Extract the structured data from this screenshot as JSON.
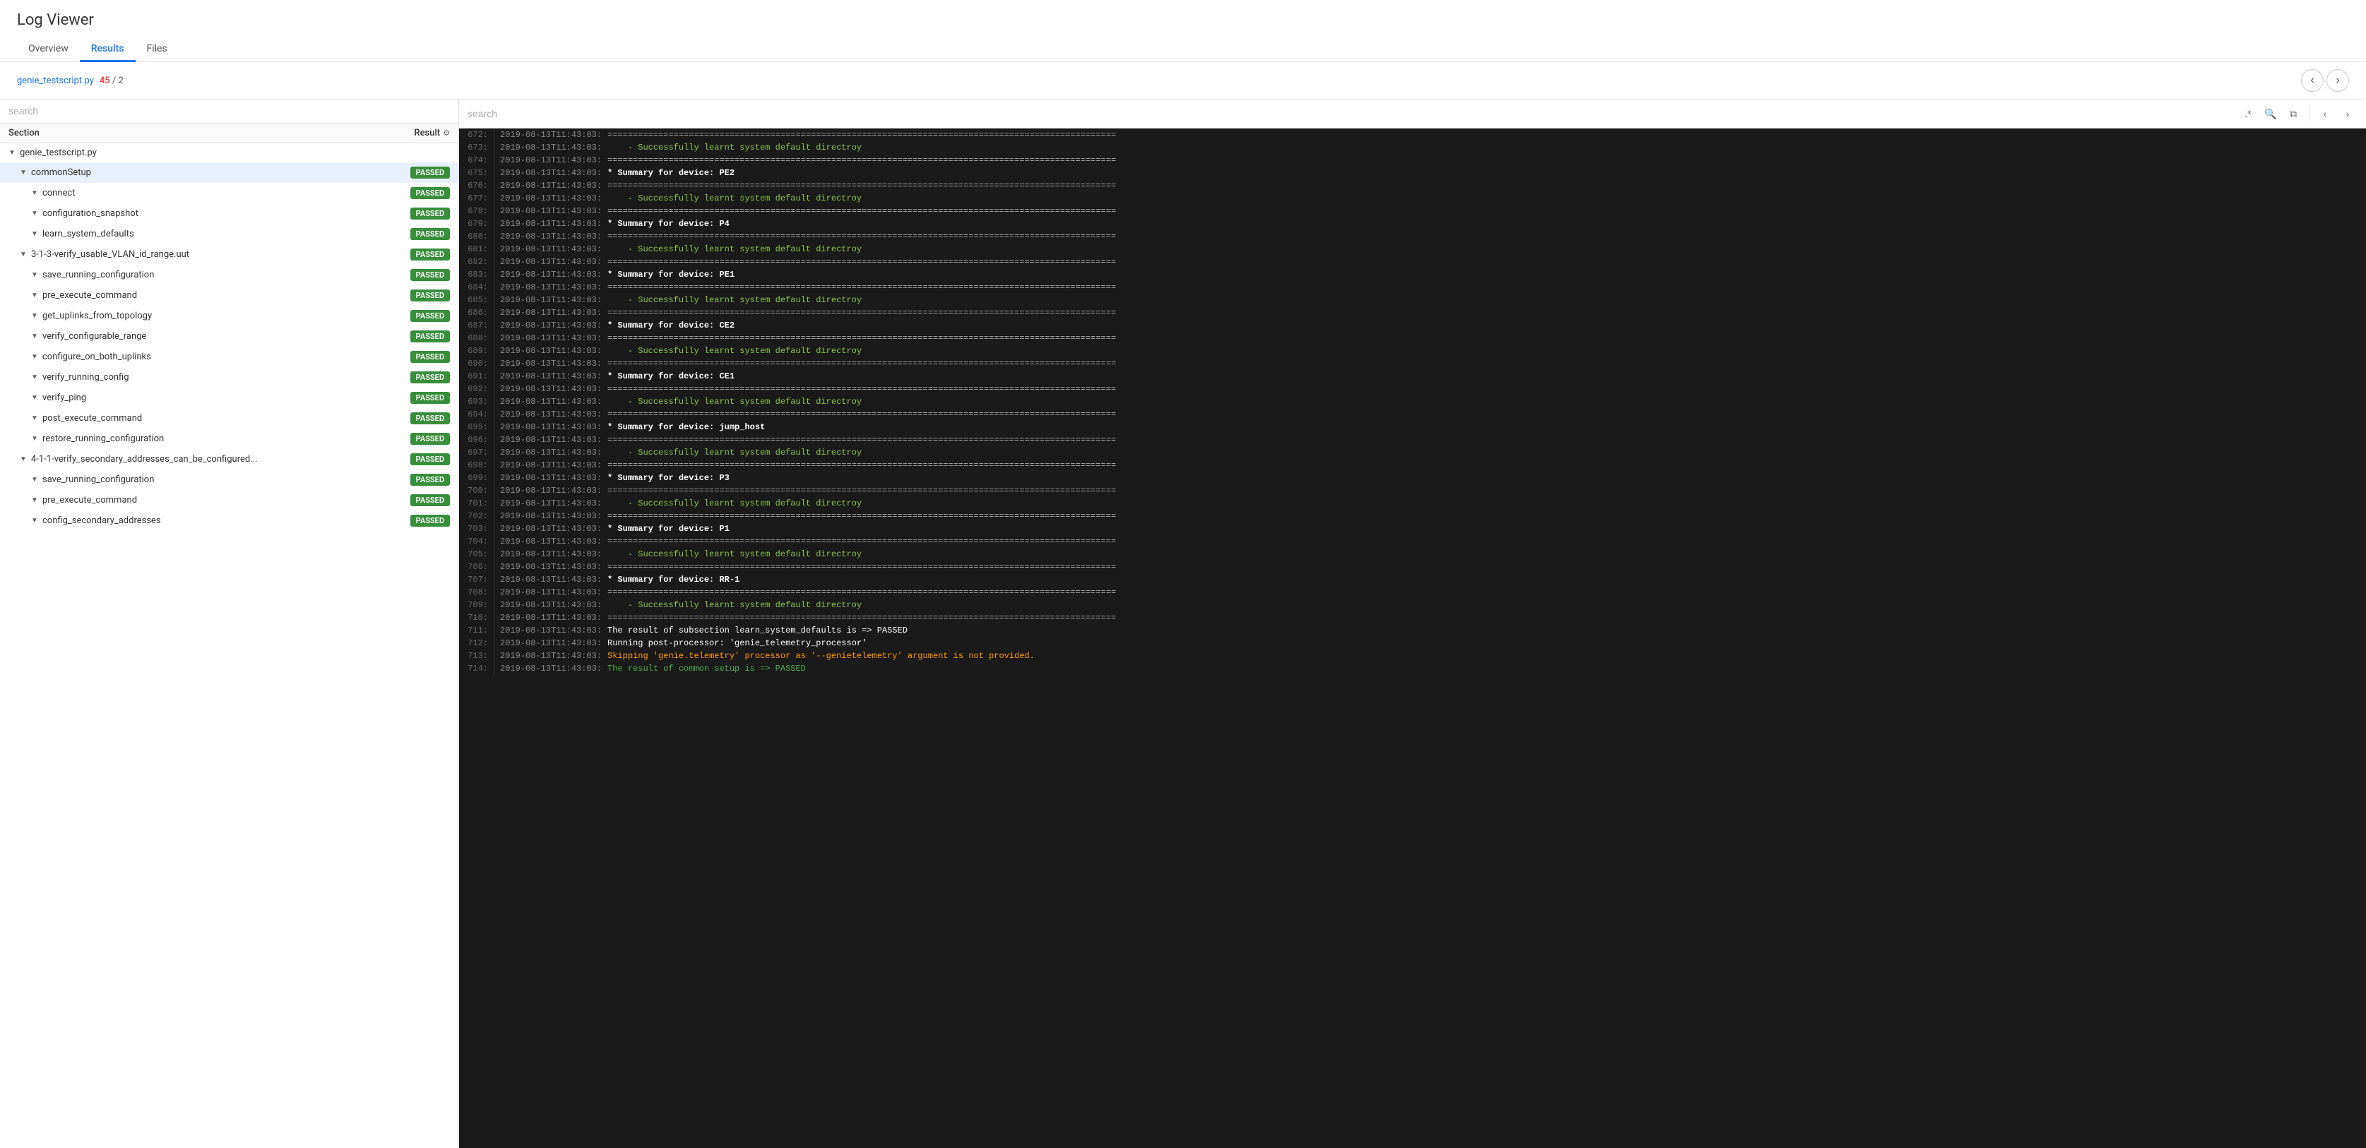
{
  "app": {
    "title": "Log Viewer"
  },
  "tabs": [
    {
      "id": "overview",
      "label": "Overview",
      "active": false
    },
    {
      "id": "results",
      "label": "Results",
      "active": true
    },
    {
      "id": "files",
      "label": "Files",
      "active": false
    }
  ],
  "subheader": {
    "file_name": "genie_testscript.py",
    "match_current": "45",
    "match_separator": "/",
    "match_total": "2"
  },
  "left_panel": {
    "search_placeholder": "search",
    "col_section": "Section",
    "col_result": "Result",
    "tree_items": [
      {
        "id": "genie_testscript",
        "label": "genie_testscript.py",
        "indent": 1,
        "chevron": "▼",
        "badge": null
      },
      {
        "id": "commonSetup",
        "label": "commonSetup",
        "indent": 2,
        "chevron": "▼",
        "badge": "PASSED",
        "selected": true
      },
      {
        "id": "connect",
        "label": "connect",
        "indent": 3,
        "chevron": "▼",
        "badge": "PASSED"
      },
      {
        "id": "configuration_snapshot",
        "label": "configuration_snapshot",
        "indent": 3,
        "chevron": "▼",
        "badge": "PASSED"
      },
      {
        "id": "learn_system_defaults",
        "label": "learn_system_defaults",
        "indent": 3,
        "chevron": "▼",
        "badge": "PASSED"
      },
      {
        "id": "verify_usable_vlan",
        "label": "3-1-3-verify_usable_VLAN_id_range.uut",
        "indent": 2,
        "chevron": "▼",
        "badge": "PASSED"
      },
      {
        "id": "save_running_config1",
        "label": "save_running_configuration",
        "indent": 3,
        "chevron": "▼",
        "badge": "PASSED"
      },
      {
        "id": "pre_execute_command1",
        "label": "pre_execute_command",
        "indent": 3,
        "chevron": "▼",
        "badge": "PASSED"
      },
      {
        "id": "get_uplinks",
        "label": "get_uplinks_from_topology",
        "indent": 3,
        "chevron": "▼",
        "badge": "PASSED"
      },
      {
        "id": "verify_configurable_range",
        "label": "verify_configurable_range",
        "indent": 3,
        "chevron": "▼",
        "badge": "PASSED"
      },
      {
        "id": "configure_on_both",
        "label": "configure_on_both_uplinks",
        "indent": 3,
        "chevron": "▼",
        "badge": "PASSED"
      },
      {
        "id": "verify_running_config",
        "label": "verify_running_config",
        "indent": 3,
        "chevron": "▼",
        "badge": "PASSED"
      },
      {
        "id": "verify_ping",
        "label": "verify_ping",
        "indent": 3,
        "chevron": "▼",
        "badge": "PASSED"
      },
      {
        "id": "post_execute_command1",
        "label": "post_execute_command",
        "indent": 3,
        "chevron": "▼",
        "badge": "PASSED"
      },
      {
        "id": "restore_running_config1",
        "label": "restore_running_configuration",
        "indent": 3,
        "chevron": "▼",
        "badge": "PASSED"
      },
      {
        "id": "verify_secondary",
        "label": "4-1-1-verify_secondary_addresses_can_be_configured...",
        "indent": 2,
        "chevron": "▼",
        "badge": "PASSED"
      },
      {
        "id": "save_running_config2",
        "label": "save_running_configuration",
        "indent": 3,
        "chevron": "▼",
        "badge": "PASSED"
      },
      {
        "id": "pre_execute_command2",
        "label": "pre_execute_command",
        "indent": 3,
        "chevron": "▼",
        "badge": "PASSED"
      },
      {
        "id": "config_secondary",
        "label": "config_secondary_addresses",
        "indent": 3,
        "chevron": "▼",
        "badge": "PASSED"
      }
    ]
  },
  "right_panel": {
    "search_placeholder": "search",
    "log_lines": [
      {
        "num": "672:",
        "time": "2019-08-13T11:43:03:",
        "content": "====================================================================================================",
        "style": "highlight-eq"
      },
      {
        "num": "673:",
        "time": "2019-08-13T11:43:03:",
        "content": "    - Successfully learnt system default directroy",
        "style": "highlight-dash"
      },
      {
        "num": "674:",
        "time": "2019-08-13T11:43:03:",
        "content": "====================================================================================================",
        "style": "highlight-eq"
      },
      {
        "num": "675:",
        "time": "2019-08-13T11:43:03:",
        "content": "* Summary for device: PE2",
        "style": "highlight-star"
      },
      {
        "num": "676:",
        "time": "2019-08-13T11:43:03:",
        "content": "====================================================================================================",
        "style": "highlight-eq"
      },
      {
        "num": "677:",
        "time": "2019-08-13T11:43:03:",
        "content": "    - Successfully learnt system default directroy",
        "style": "highlight-dash"
      },
      {
        "num": "678:",
        "time": "2019-08-13T11:43:03:",
        "content": "====================================================================================================",
        "style": "highlight-eq"
      },
      {
        "num": "679:",
        "time": "2019-08-13T11:43:03:",
        "content": "* Summary for device: P4",
        "style": "highlight-star"
      },
      {
        "num": "680:",
        "time": "2019-08-13T11:43:03:",
        "content": "====================================================================================================",
        "style": "highlight-eq"
      },
      {
        "num": "681:",
        "time": "2019-08-13T11:43:03:",
        "content": "    - Successfully learnt system default directroy",
        "style": "highlight-dash"
      },
      {
        "num": "682:",
        "time": "2019-08-13T11:43:03:",
        "content": "====================================================================================================",
        "style": "highlight-eq"
      },
      {
        "num": "683:",
        "time": "2019-08-13T11:43:03:",
        "content": "* Summary for device: PE1",
        "style": "highlight-star"
      },
      {
        "num": "684:",
        "time": "2019-08-13T11:43:03:",
        "content": "====================================================================================================",
        "style": "highlight-eq"
      },
      {
        "num": "685:",
        "time": "2019-08-13T11:43:03:",
        "content": "    - Successfully learnt system default directroy",
        "style": "highlight-dash"
      },
      {
        "num": "686:",
        "time": "2019-08-13T11:43:03:",
        "content": "====================================================================================================",
        "style": "highlight-eq"
      },
      {
        "num": "687:",
        "time": "2019-08-13T11:43:03:",
        "content": "* Summary for device: CE2",
        "style": "highlight-star"
      },
      {
        "num": "688:",
        "time": "2019-08-13T11:43:03:",
        "content": "====================================================================================================",
        "style": "highlight-eq"
      },
      {
        "num": "689:",
        "time": "2019-08-13T11:43:03:",
        "content": "    - Successfully learnt system default directroy",
        "style": "highlight-dash"
      },
      {
        "num": "690:",
        "time": "2019-08-13T11:43:03:",
        "content": "====================================================================================================",
        "style": "highlight-eq"
      },
      {
        "num": "691:",
        "time": "2019-08-13T11:43:03:",
        "content": "* Summary for device: CE1",
        "style": "highlight-star"
      },
      {
        "num": "692:",
        "time": "2019-08-13T11:43:03:",
        "content": "====================================================================================================",
        "style": "highlight-eq"
      },
      {
        "num": "693:",
        "time": "2019-08-13T11:43:03:",
        "content": "    - Successfully learnt system default directroy",
        "style": "highlight-dash"
      },
      {
        "num": "694:",
        "time": "2019-08-13T11:43:03:",
        "content": "====================================================================================================",
        "style": "highlight-eq"
      },
      {
        "num": "695:",
        "time": "2019-08-13T11:43:03:",
        "content": "* Summary for device: jump_host",
        "style": "highlight-star"
      },
      {
        "num": "696:",
        "time": "2019-08-13T11:43:03:",
        "content": "====================================================================================================",
        "style": "highlight-eq"
      },
      {
        "num": "697:",
        "time": "2019-08-13T11:43:03:",
        "content": "    - Successfully learnt system default directroy",
        "style": "highlight-dash"
      },
      {
        "num": "698:",
        "time": "2019-08-13T11:43:03:",
        "content": "====================================================================================================",
        "style": "highlight-eq"
      },
      {
        "num": "699:",
        "time": "2019-08-13T11:43:03:",
        "content": "* Summary for device: P3",
        "style": "highlight-star"
      },
      {
        "num": "700:",
        "time": "2019-08-13T11:43:03:",
        "content": "====================================================================================================",
        "style": "highlight-eq"
      },
      {
        "num": "701:",
        "time": "2019-08-13T11:43:03:",
        "content": "    - Successfully learnt system default directroy",
        "style": "highlight-dash"
      },
      {
        "num": "702:",
        "time": "2019-08-13T11:43:03:",
        "content": "====================================================================================================",
        "style": "highlight-eq"
      },
      {
        "num": "703:",
        "time": "2019-08-13T11:43:03:",
        "content": "* Summary for device: P1",
        "style": "highlight-star"
      },
      {
        "num": "704:",
        "time": "2019-08-13T11:43:03:",
        "content": "====================================================================================================",
        "style": "highlight-eq"
      },
      {
        "num": "705:",
        "time": "2019-08-13T11:43:03:",
        "content": "    - Successfully learnt system default directroy",
        "style": "highlight-dash"
      },
      {
        "num": "706:",
        "time": "2019-08-13T11:43:03:",
        "content": "====================================================================================================",
        "style": "highlight-eq"
      },
      {
        "num": "707:",
        "time": "2019-08-13T11:43:03:",
        "content": "* Summary for device: RR-1",
        "style": "highlight-star"
      },
      {
        "num": "708:",
        "time": "2019-08-13T11:43:03:",
        "content": "====================================================================================================",
        "style": "highlight-eq"
      },
      {
        "num": "709:",
        "time": "2019-08-13T11:43:03:",
        "content": "    - Successfully learnt system default directroy",
        "style": "highlight-dash"
      },
      {
        "num": "710:",
        "time": "2019-08-13T11:43:03:",
        "content": "====================================================================================================",
        "style": "highlight-eq"
      },
      {
        "num": "711:",
        "time": "2019-08-13T11:43:03:",
        "content": "The result of subsection learn_system_defaults is => PASSED",
        "style": "highlight-result"
      },
      {
        "num": "712:",
        "time": "2019-08-13T11:43:03:",
        "content": "Running post-processor: 'genie_telemetry_processor'",
        "style": "highlight-result"
      },
      {
        "num": "713:",
        "time": "2019-08-13T11:43:03:",
        "content": "Skipping 'genie.telemetry' processor as '--genietelemetry' argument is not provided.",
        "style": "highlight-skip"
      },
      {
        "num": "714:",
        "time": "2019-08-13T11:43:03:",
        "content": "The result of common setup is => PASSED",
        "style": "highlight-passed"
      }
    ],
    "toolbar": {
      "regex_label": ".*",
      "search_icon": "🔍",
      "copy_icon": "⧉",
      "prev_icon": "‹",
      "next_icon": "›"
    }
  },
  "colors": {
    "accent": "#1a73e8",
    "passed": "#388e3c",
    "error": "#e53935"
  }
}
